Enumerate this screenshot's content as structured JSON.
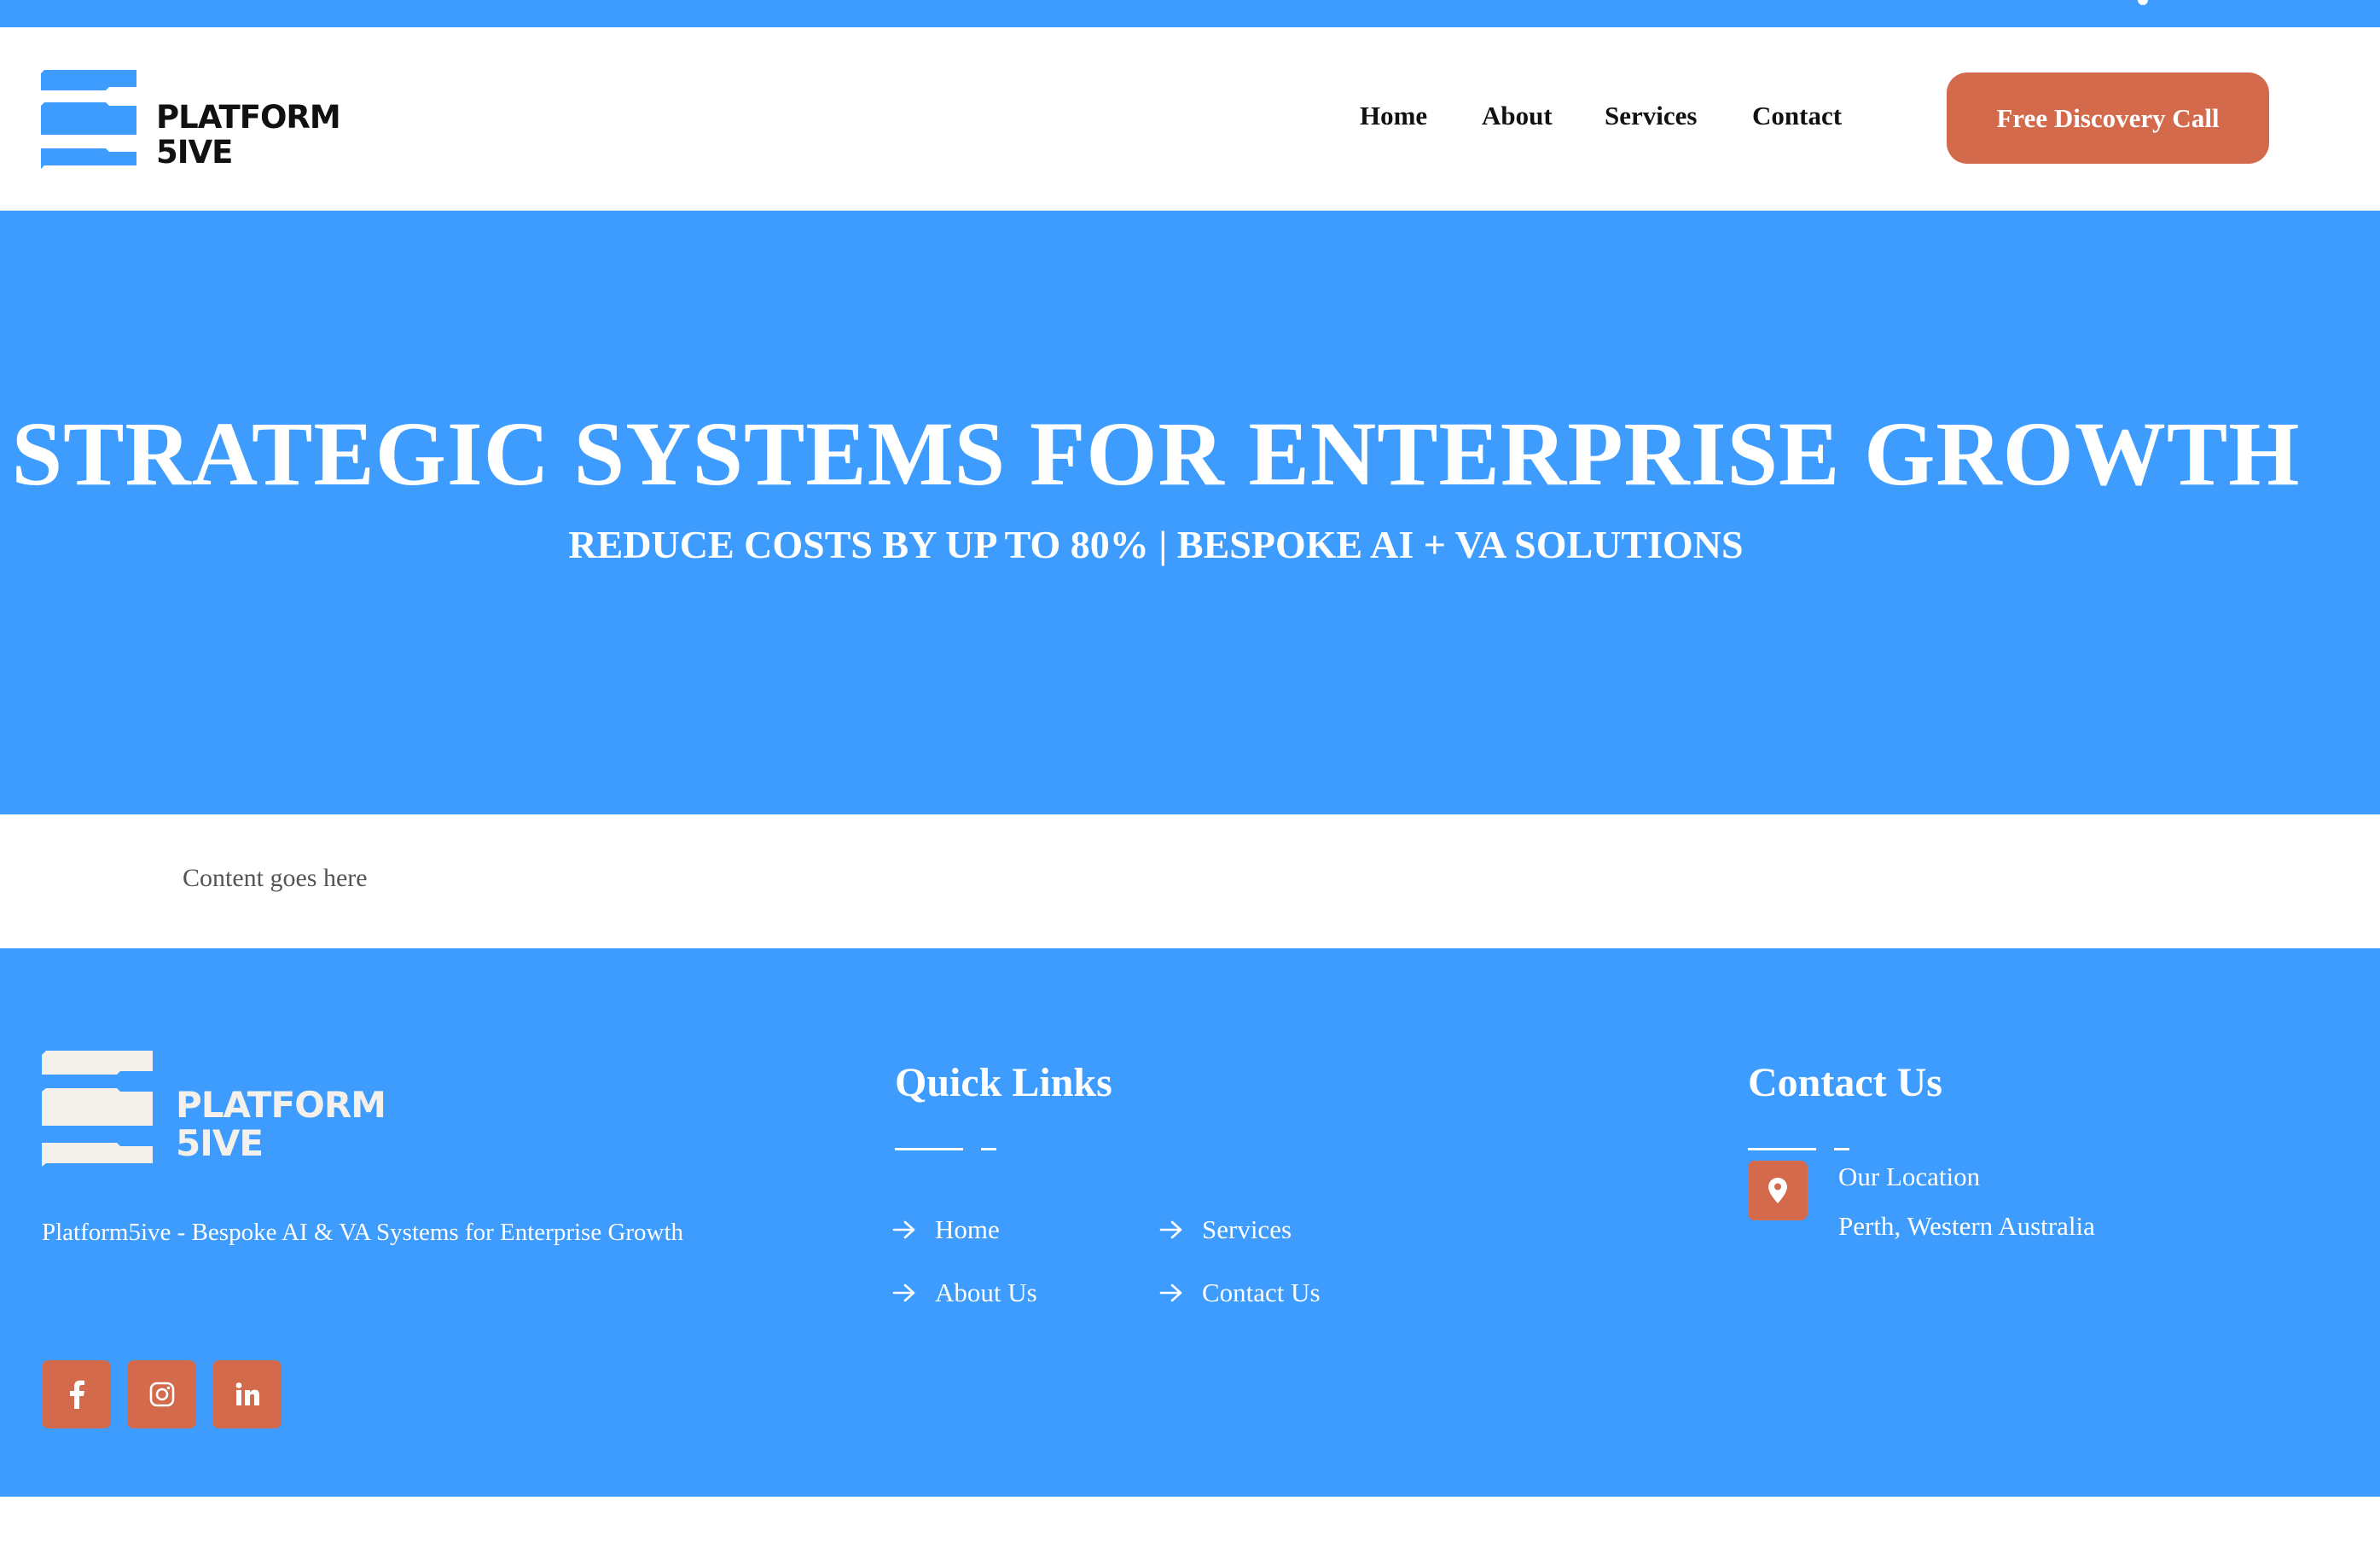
{
  "colors": {
    "primary_blue": "#3d9cfd",
    "accent_orange": "#d46a4c",
    "text_dark": "#111111",
    "text_muted": "#555555",
    "logo_light": "#f4f1ec"
  },
  "header": {
    "logo": {
      "line1": "PLATFORM",
      "line2": "5IVE"
    },
    "nav": [
      {
        "label": "Home"
      },
      {
        "label": "About"
      },
      {
        "label": "Services"
      },
      {
        "label": "Contact"
      }
    ],
    "cta_label": "Free Discovery Call"
  },
  "hero": {
    "title": "STRATEGIC SYSTEMS FOR ENTERPRISE GROWTH",
    "subtitle": "REDUCE COSTS BY UP TO 80% | BESPOKE AI + VA SOLUTIONS"
  },
  "content": {
    "text": "Content goes here"
  },
  "footer": {
    "logo": {
      "line1": "PLATFORM",
      "line2": "5IVE"
    },
    "description": "Platform5ive - Bespoke AI & VA Systems for Enterprise Growth",
    "social": [
      {
        "icon": "facebook-icon"
      },
      {
        "icon": "instagram-icon"
      },
      {
        "icon": "linkedin-icon"
      }
    ],
    "quick_links": {
      "heading": "Quick Links",
      "items": [
        {
          "label": "Home"
        },
        {
          "label": "Services"
        },
        {
          "label": "About Us"
        },
        {
          "label": "Contact Us"
        }
      ]
    },
    "contact": {
      "heading": "Contact Us",
      "location_label": "Our Location",
      "location_value": "Perth, Western Australia"
    }
  }
}
